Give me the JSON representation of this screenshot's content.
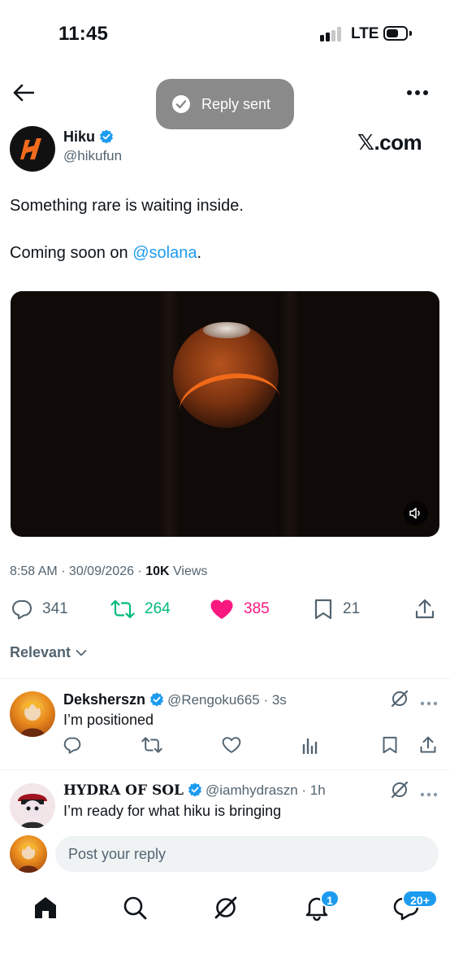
{
  "status_bar": {
    "time": "11:45",
    "network": "LTE"
  },
  "toast": {
    "text": "Reply sent"
  },
  "post": {
    "author_name": "Hiku",
    "author_handle": "@hikufun",
    "brand_label": "𝕏.com",
    "text_line1": "Something rare is waiting inside.",
    "text_line2_prefix": "Coming soon on ",
    "text_line2_mention": "@solana",
    "text_line2_suffix": ".",
    "timestamp": "8:58 AM · 30/09/2026 · ",
    "views_count": "10K",
    "views_label": " Views",
    "stats": {
      "replies": "341",
      "reposts": "264",
      "likes": "385",
      "bookmarks": "21"
    }
  },
  "replies_filter": {
    "label": "Relevant"
  },
  "replies": [
    {
      "name": "Deksherszn",
      "handle": "@Rengoku665 · 3s",
      "text": "I’m positioned"
    },
    {
      "name": "HYDRA OF SOL",
      "handle": "@iamhydraszn · 1h",
      "text": "I’m ready for what hiku is bringing"
    }
  ],
  "compose": {
    "placeholder": "Post your reply"
  },
  "tabbar": {
    "notifications_badge": "1",
    "messages_badge": "20+"
  },
  "colors": {
    "accent": "#1d9bf0",
    "like": "#f91880",
    "repost": "#00ba7c",
    "muted": "#536471",
    "toast_bg": "#8a8a8a"
  },
  "icons": [
    "back-arrow-icon",
    "more-icon",
    "check-icon",
    "verified-icon",
    "sound-icon",
    "reply-icon",
    "repost-icon",
    "like-icon",
    "bookmark-icon",
    "share-icon",
    "chevron-down-icon",
    "grok-icon",
    "analytics-icon",
    "home-icon",
    "search-icon",
    "notifications-icon",
    "messages-icon"
  ]
}
